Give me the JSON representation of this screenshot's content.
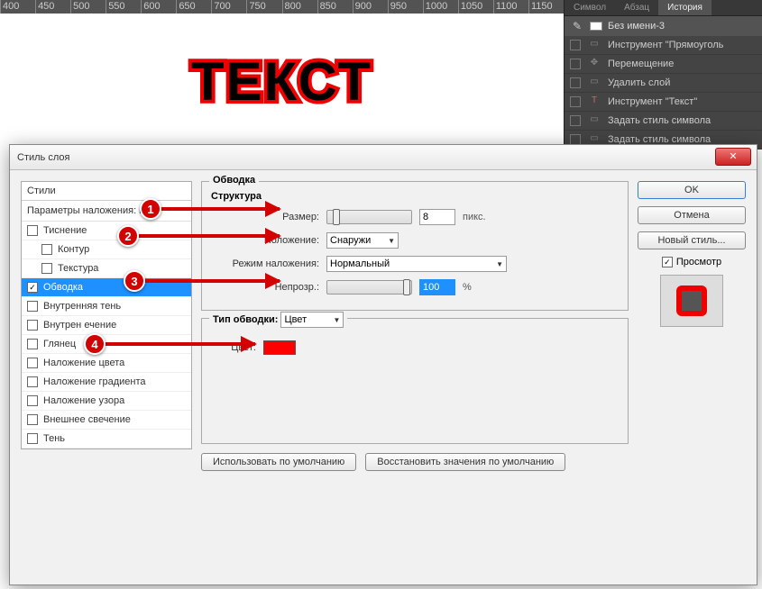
{
  "ruler_marks": [
    "400",
    "450",
    "500",
    "550",
    "600",
    "650",
    "700",
    "750",
    "800",
    "850",
    "900",
    "950",
    "1000",
    "1050",
    "1100",
    "1150"
  ],
  "canvas_text": "ТЕКСТ",
  "panel_tabs": {
    "symbol": "Символ",
    "para": "Абзац",
    "history": "История"
  },
  "doc_name": "Без имени-3",
  "history": [
    {
      "label": "Инструмент \"Прямоуголь"
    },
    {
      "label": "Перемещение"
    },
    {
      "label": "Удалить слой"
    },
    {
      "label": "Инструмент \"Текст\""
    },
    {
      "label": "Задать стиль символа"
    },
    {
      "label": "Задать стиль символа"
    }
  ],
  "dialog": {
    "title": "Стиль слоя",
    "styles_header": "Стили",
    "blend_options": "Параметры наложения: п",
    "items": [
      {
        "label": "Тиснение",
        "checked": false,
        "indent": false
      },
      {
        "label": "Контур",
        "checked": false,
        "indent": true
      },
      {
        "label": "Текстура",
        "checked": false,
        "indent": true
      },
      {
        "label": "Обводка",
        "checked": true,
        "indent": false,
        "selected": true
      },
      {
        "label": "Внутренняя тень",
        "checked": false,
        "indent": false
      },
      {
        "label": "Внутреннее свечение",
        "checked": false,
        "indent": false,
        "trunc": "Внутрен            ечение"
      },
      {
        "label": "Глянец",
        "checked": false,
        "indent": false
      },
      {
        "label": "Наложение цвета",
        "checked": false,
        "indent": false
      },
      {
        "label": "Наложение градиента",
        "checked": false,
        "indent": false
      },
      {
        "label": "Наложение узора",
        "checked": false,
        "indent": false
      },
      {
        "label": "Внешнее свечение",
        "checked": false,
        "indent": false
      },
      {
        "label": "Тень",
        "checked": false,
        "indent": false
      }
    ],
    "stroke": {
      "group_title": "Обводка",
      "structure": "Структура",
      "size_label": "Размер:",
      "size": "8",
      "size_unit": "пикс.",
      "position_label": "Положение:",
      "position": "Снаружи",
      "blend_label": "Режим наложения:",
      "blend": "Нормальный",
      "opacity_label": "Непрозр.:",
      "opacity": "100",
      "opacity_unit": "%",
      "type_group": "Тип обводки:",
      "type": "Цвет",
      "color_label": "Цвет:",
      "color": "#ff0000",
      "btn_default": "Использовать по умолчанию",
      "btn_reset": "Восстановить значения по умолчанию"
    },
    "buttons": {
      "ok": "OK",
      "cancel": "Отмена",
      "new_style": "Новый стиль...",
      "preview": "Просмотр"
    }
  },
  "annotations": [
    "1",
    "2",
    "3",
    "4"
  ]
}
